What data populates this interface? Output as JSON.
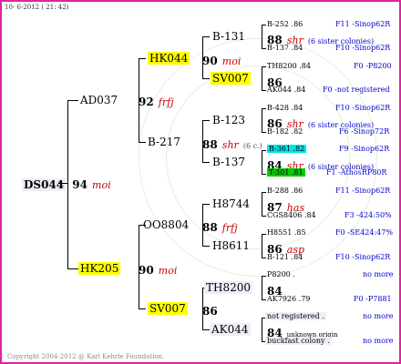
{
  "header": "10- 6-2012 ( 21: 42)",
  "copyright": "Copyright 2004-2012 @ Karl Kehrle Foundation.",
  "root": {
    "name": "DS044",
    "num": "94",
    "sym": "moi"
  },
  "g1": [
    {
      "name": "AD037",
      "num": "92",
      "sym": "frfj"
    },
    {
      "name": "HK205",
      "num": "90",
      "sym": "moi"
    }
  ],
  "g2": [
    {
      "name": "HK044",
      "num": "90",
      "sym": "moi"
    },
    {
      "name": "B-217",
      "num": "88",
      "sym": "shr",
      "note": "(6 c.)"
    },
    {
      "name": "OO8804",
      "num": "88",
      "sym": "frfj"
    },
    {
      "name": "SV007",
      "num": "86",
      "sym": ""
    }
  ],
  "g3": [
    {
      "name": "B-131"
    },
    {
      "name": "SV007"
    },
    {
      "name": "B-123"
    },
    {
      "name": "B-137"
    },
    {
      "name": "H8744"
    },
    {
      "name": "H8611"
    },
    {
      "name": "TH8200"
    },
    {
      "name": "AK044"
    }
  ],
  "g4": [
    {
      "name": "B-252 .86",
      "num": "88",
      "sym": "shr",
      "sub": "(6 sister colonies)",
      "tail": "B-137 .84",
      "right1": "F11 -Sinop62R",
      "right2": "F10 -Sinop62R"
    },
    {
      "name": "TH8200 .84",
      "num": "86",
      "sym": "",
      "sub": "",
      "tail": "AK044 .84",
      "right1": "F0 -P8200",
      "right2": "F0 -not registered"
    },
    {
      "name": "B-428 .84",
      "num": "86",
      "sym": "shr",
      "sub": "(6 sister colonies)",
      "tail": "B-182 .82",
      "right1": "F10 -Sinop62R",
      "right2": "F6 -Sinop72R"
    },
    {
      "name": "B-361 .82",
      "num": "84",
      "sym": "shr",
      "sub": "(6 sister colonies)",
      "tail": "T-301 .81",
      "right1": "F9 -Sinop62R",
      "right2": "F1 -AthosRP80R"
    },
    {
      "name": "B-288 .86",
      "num": "87",
      "sym": "has",
      "sub": "",
      "tail": "CGS8406 .84",
      "right1": "F11 -Sinop62R",
      "right2": "F3 -424:50%"
    },
    {
      "name": "H8551 .85",
      "num": "86",
      "sym": "asp",
      "sub": "",
      "tail": "B-121 .84",
      "right1": "F0 -SE424:47%",
      "right2": "F10 -Sinop62R"
    },
    {
      "name": "P8200 .",
      "num": "84",
      "sym": "",
      "sub": "",
      "tail": "AK7926 .79",
      "right1": "no more",
      "right2": "F0 -P7881"
    },
    {
      "name": "not registered .",
      "num": "84",
      "sym": "",
      "sub": "unknown origin",
      "tail": "buckfast colony .",
      "right1": "no more",
      "right2": "no more"
    }
  ]
}
